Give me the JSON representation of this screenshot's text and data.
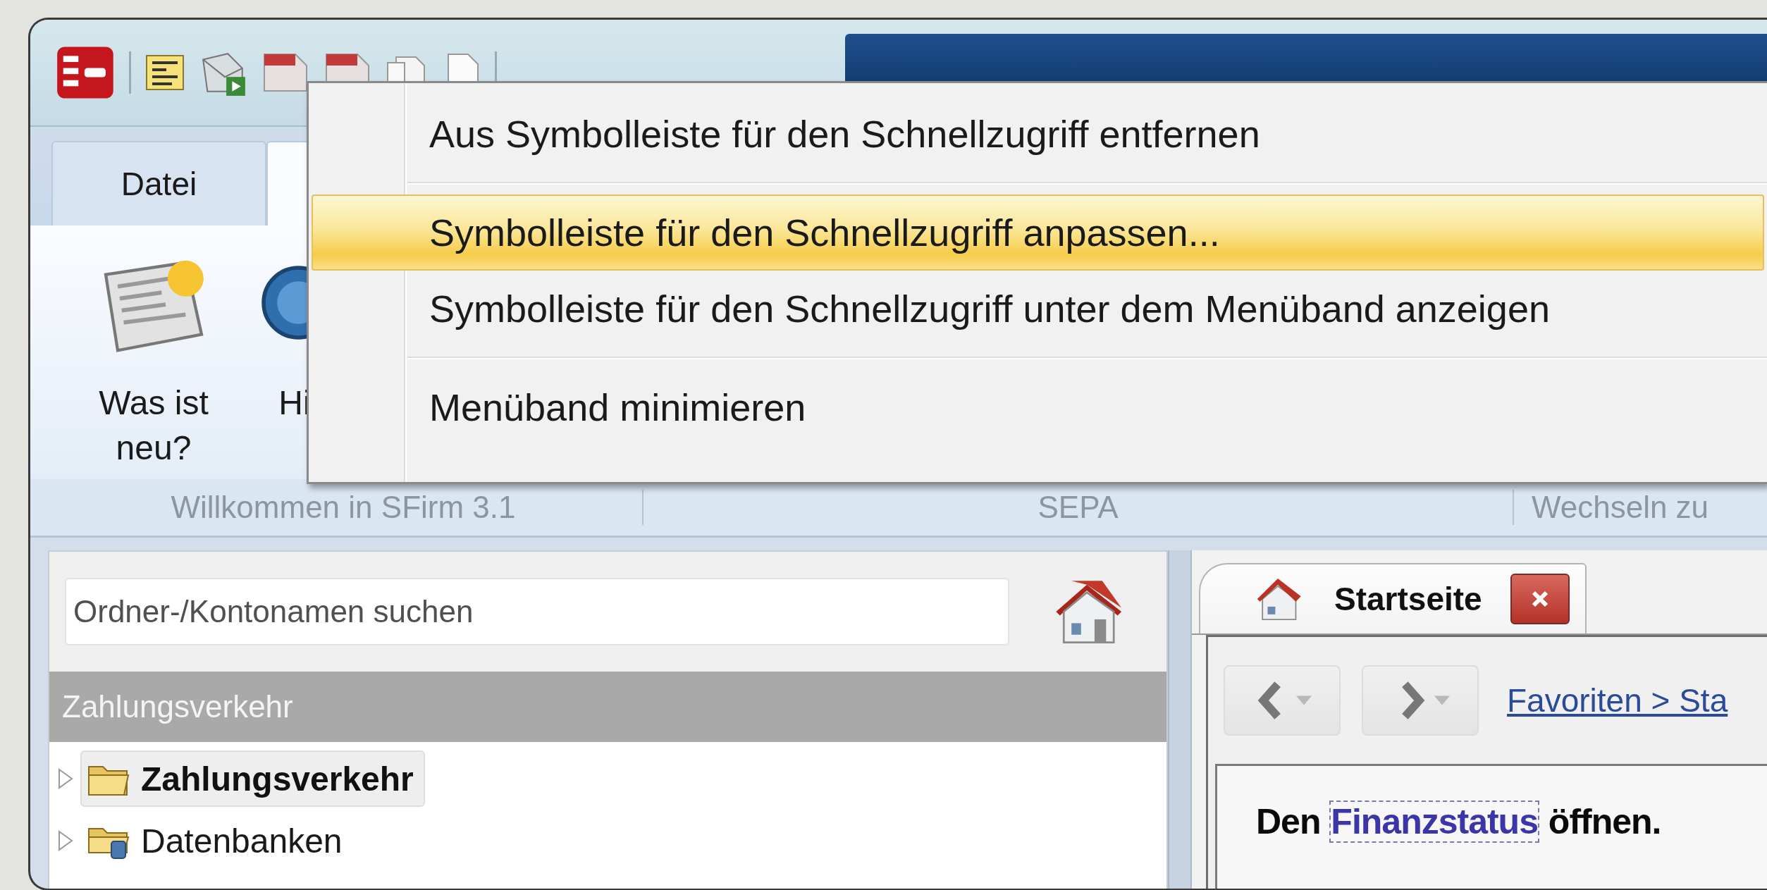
{
  "ribbon": {
    "tabs": [
      {
        "label": "Datei",
        "selected": false
      },
      {
        "selected": true
      }
    ],
    "buttons": [
      {
        "kind": "news",
        "label": "Was ist neu?"
      },
      {
        "kind": "help",
        "label": "Hi"
      }
    ],
    "groups": [
      "Willkommen in SFirm 3.1",
      "SEPA",
      "Wechseln zu"
    ]
  },
  "context_menu": {
    "items": [
      {
        "label": "Aus Symbolleiste für den Schnellzugriff entfernen",
        "selected": false,
        "separator_after": true
      },
      {
        "label": "Symbolleiste für den Schnellzugriff anpassen...",
        "selected": true,
        "separator_after": false
      },
      {
        "label": "Symbolleiste für den Schnellzugriff unter dem Menüband anzeigen",
        "selected": false,
        "separator_after": true
      },
      {
        "label": "Menüband minimieren",
        "selected": false,
        "separator_after": false
      }
    ]
  },
  "folder_pane": {
    "search": {
      "placeholder": "Ordner-/Kontonamen suchen"
    },
    "header": "Zahlungsverkehr",
    "tree": [
      {
        "label": "Zahlungsverkehr",
        "kind": "folder",
        "selected": true,
        "expanded": false
      },
      {
        "label": "Datenbanken",
        "kind": "database",
        "selected": false,
        "expanded": false
      }
    ]
  },
  "content": {
    "tabs": [
      {
        "label": "Startseite",
        "selected": true
      }
    ],
    "navigation": {
      "back_disabled": true,
      "forward_disabled": true
    },
    "breadcrumb": "Favoriten > Sta",
    "message": {
      "before": "Den ",
      "link": "Finanzstatus",
      "after": " öffnen."
    }
  }
}
